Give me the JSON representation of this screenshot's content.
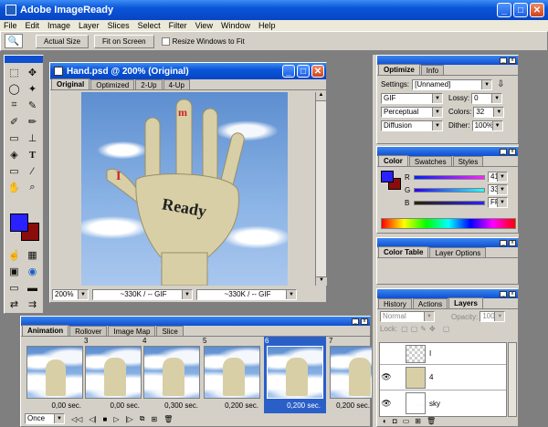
{
  "app": {
    "title": "Adobe ImageReady"
  },
  "menu": [
    "File",
    "Edit",
    "Image",
    "Layer",
    "Slices",
    "Select",
    "Filter",
    "View",
    "Window",
    "Help"
  ],
  "options_bar": {
    "actual_size": "Actual Size",
    "fit_on_screen": "Fit on Screen",
    "resize_windows": "Resize Windows to Fit"
  },
  "document": {
    "title": "Hand.psd @ 200% (Original)",
    "tabs": [
      "Original",
      "Optimized",
      "2-Up",
      "4-Up"
    ],
    "zoom": "200%",
    "size1": "~330K / -- GIF",
    "size2": "~330K / -- GIF",
    "hand_text": "Ready",
    "letter_i": "I",
    "letter_m": "m"
  },
  "optimize": {
    "tabs": [
      "Optimize",
      "Info"
    ],
    "settings_label": "Settings:",
    "settings_value": "[Unnamed]",
    "format": "GIF",
    "lossy_label": "Lossy:",
    "lossy_value": "0",
    "reduction": "Perceptual",
    "colors_label": "Colors:",
    "colors_value": "32",
    "dither_method": "Diffusion",
    "dither_label": "Dither:",
    "dither_value": "100%"
  },
  "color_panel": {
    "tabs": [
      "Color",
      "Swatches",
      "Styles"
    ],
    "r_label": "R",
    "r_value": "41",
    "g_label": "G",
    "g_value": "33",
    "b_label": "B",
    "b_value": "FF",
    "fg_color": "#2921ff",
    "bg_color": "#8b0c0c"
  },
  "color_table": {
    "tabs": [
      "Color Table",
      "Layer Options"
    ]
  },
  "layers": {
    "tabs": [
      "History",
      "Actions",
      "Layers"
    ],
    "blend": "Normal",
    "opacity_label": "Opacity:",
    "opacity_value": "100%",
    "lock_label": "Lock:",
    "items": [
      {
        "name": "I"
      },
      {
        "name": "4"
      },
      {
        "name": "sky"
      }
    ]
  },
  "animation": {
    "tabs": [
      "Animation",
      "Rollover",
      "Image Map",
      "Slice"
    ],
    "loop": "Once",
    "frames": [
      {
        "num": "",
        "time": "0,00 sec."
      },
      {
        "num": "3",
        "time": "0,00 sec."
      },
      {
        "num": "4",
        "time": "0,300 sec."
      },
      {
        "num": "5",
        "time": "0,200 sec."
      },
      {
        "num": "6",
        "time": "0,200 sec."
      },
      {
        "num": "7",
        "time": "0,200 sec."
      }
    ]
  }
}
